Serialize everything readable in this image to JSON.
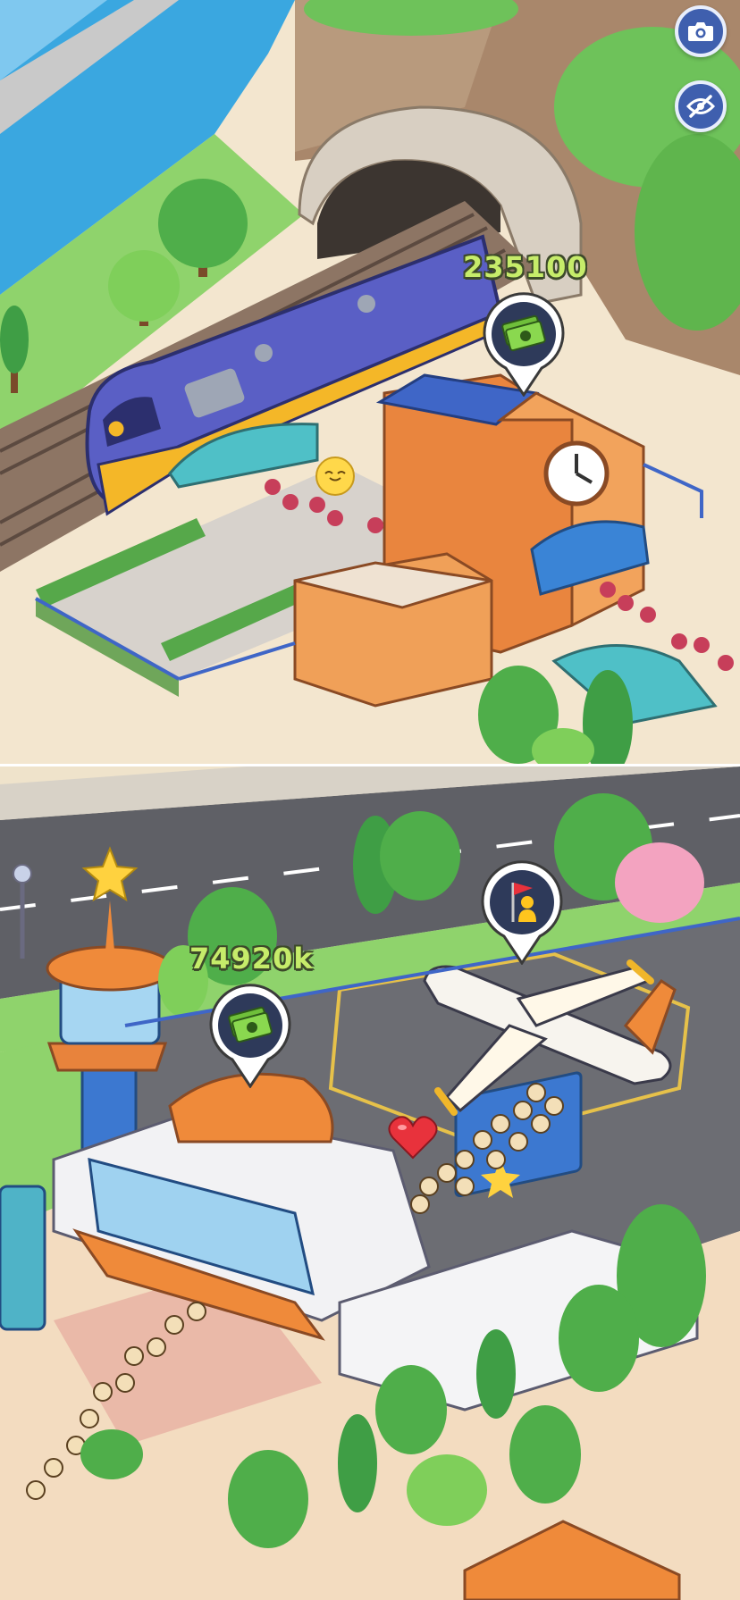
{
  "hud": {
    "camera_icon": "camera-icon",
    "hide_icon": "eye-slash-icon"
  },
  "station": {
    "income_label": "235100",
    "income_icon": "cash-icon",
    "mood_icon": "smile-emoji-icon"
  },
  "airport": {
    "income_label": "74920k",
    "income_icon": "cash-icon",
    "flag_icon": "flag-person-icon",
    "heart_icon": "heart-icon"
  },
  "colors": {
    "money_text": "#c6ec6a",
    "pin_bg": "#2e3a5a",
    "hud_button": "#3f5fae"
  }
}
